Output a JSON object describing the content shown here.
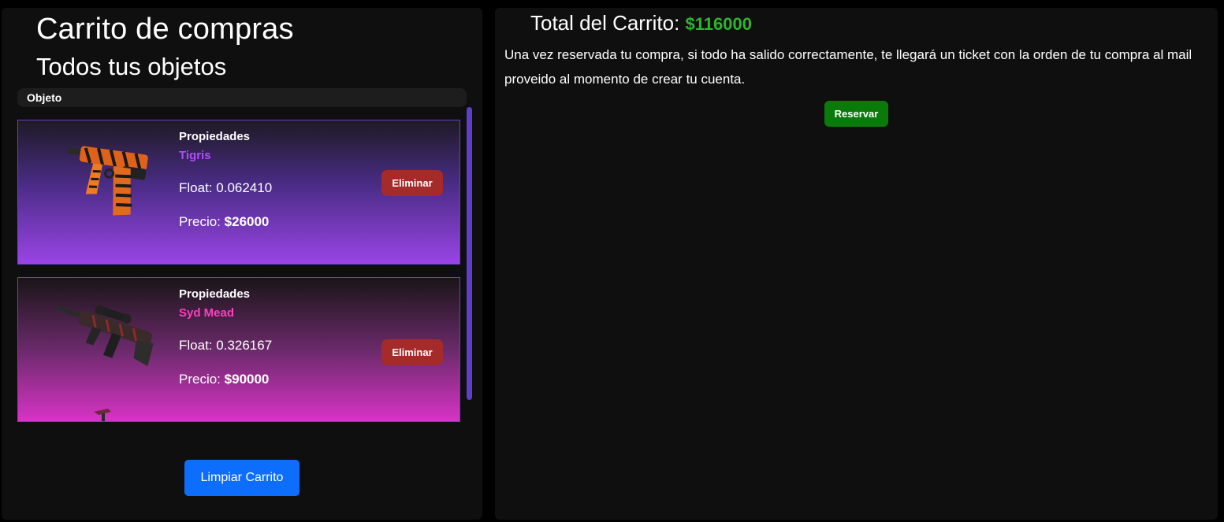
{
  "cart": {
    "title": "Carrito de compras",
    "subtitle": "Todos tus objetos",
    "column_header": "Objeto",
    "clear_button": "Limpiar Carrito",
    "items": [
      {
        "properties_label": "Propiedades",
        "skin_name": "Tigris",
        "skin_color": "#b04cff",
        "float_label": "Float:",
        "float_value": "0.062410",
        "price_label": "Precio:",
        "price_value": "$26000",
        "remove_button": "Eliminar",
        "icon": "pistol-weapon-icon"
      },
      {
        "properties_label": "Propiedades",
        "skin_name": "Syd Mead",
        "skin_color": "#ff3fbf",
        "float_label": "Float:",
        "float_value": "0.326167",
        "price_label": "Precio:",
        "price_value": "$90000",
        "remove_button": "Eliminar",
        "icon": "rifle-weapon-icon"
      }
    ]
  },
  "summary": {
    "total_label": "Total del Carrito:",
    "total_value": "$116000",
    "total_color": "#2db52d",
    "info_text": "Una vez reservada tu compra, si todo ha salido correctamente, te llegará un ticket con la orden de tu compra al mail proveido al momento de crear tu cuenta.",
    "reserve_button": "Reservar"
  },
  "colors": {
    "clear_button": "#0d6efd",
    "remove_button": "#a52a2a",
    "reserve_button": "#0a7a0a",
    "scrollbar": "#5e3fc7"
  }
}
